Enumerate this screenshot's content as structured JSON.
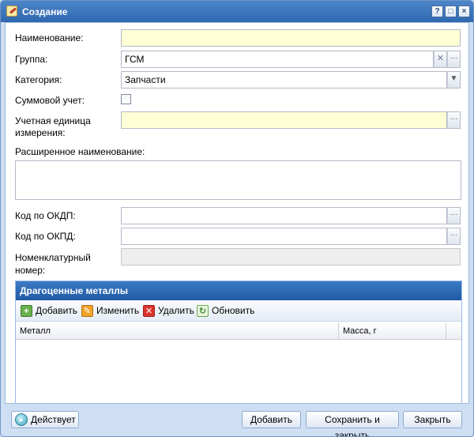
{
  "window": {
    "title": "Создание",
    "controls": [
      "?",
      "□",
      "×"
    ]
  },
  "form": {
    "name": {
      "label": "Наименование:",
      "value": ""
    },
    "group": {
      "label": "Группа:",
      "value": "ГСМ"
    },
    "category": {
      "label": "Категория:",
      "value": "Запчасти"
    },
    "summary": {
      "label": "Суммовой учет:",
      "checked": false
    },
    "unit": {
      "label_line1": "Учетная единица",
      "label_line2": "измерения:",
      "value": ""
    },
    "extended_name": {
      "label": "Расширенное наименование:",
      "value": ""
    },
    "okdp": {
      "label": "Код по ОКДП:",
      "value": ""
    },
    "okpd": {
      "label": "Код по ОКПД:",
      "value": ""
    },
    "nomenclature": {
      "label_line1": "Номенклатурный",
      "label_line2": "номер:",
      "value": ""
    }
  },
  "metals_panel": {
    "title": "Драгоценные металлы",
    "toolbar": {
      "add": "Добавить",
      "edit": "Изменить",
      "delete": "Удалить",
      "refresh": "Обновить"
    },
    "columns": [
      "Металл",
      "Масса, г"
    ],
    "rows": []
  },
  "footer": {
    "status": "Действует",
    "add": "Добавить",
    "save_close": "Сохранить и закрыть",
    "close": "Закрыть"
  },
  "icons": {
    "title": "form-edit-icon",
    "status": "status-active-icon"
  }
}
